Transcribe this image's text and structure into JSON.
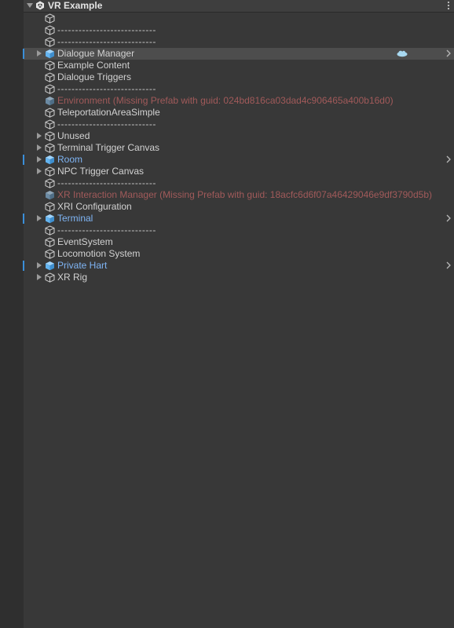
{
  "scene": {
    "title": "VR Example"
  },
  "rows": [
    {
      "label": "",
      "icon": "cube-outline-icon"
    },
    {
      "label": "----------------------------",
      "icon": "cube-outline-icon"
    },
    {
      "label": "----------------------------",
      "icon": "cube-outline-icon"
    },
    {
      "label": "Dialogue Manager",
      "icon": "prefab-cube-icon",
      "foldout": true,
      "selected": true,
      "chevron": true,
      "cloud": true
    },
    {
      "label": "Example Content",
      "icon": "cube-outline-icon"
    },
    {
      "label": "Dialogue Triggers",
      "icon": "cube-outline-icon"
    },
    {
      "label": "----------------------------",
      "icon": "cube-outline-icon"
    },
    {
      "label": "Environment (Missing Prefab with guid: 024bd816ca03dad4c906465a400b16d0)",
      "icon": "missing-prefab-icon",
      "kind": "missing"
    },
    {
      "label": "TeleportationAreaSimple",
      "icon": "cube-outline-icon"
    },
    {
      "label": "----------------------------",
      "icon": "cube-outline-icon"
    },
    {
      "label": "Unused",
      "icon": "cube-outline-icon",
      "foldout": true
    },
    {
      "label": "Terminal Trigger Canvas",
      "icon": "cube-outline-icon",
      "foldout": true
    },
    {
      "label": "Room",
      "icon": "prefab-cube-icon",
      "foldout": true,
      "kind": "prefab",
      "chevron": true,
      "mark": true
    },
    {
      "label": "NPC Trigger Canvas",
      "icon": "cube-outline-icon",
      "foldout": true
    },
    {
      "label": "----------------------------",
      "icon": "cube-outline-icon"
    },
    {
      "label": "XR Interaction Manager (Missing Prefab with guid: 18acfc6d6f07a46429046e9df3790d5b)",
      "icon": "missing-prefab-icon",
      "kind": "missing"
    },
    {
      "label": "XRI Configuration",
      "icon": "cube-outline-icon"
    },
    {
      "label": "Terminal",
      "icon": "prefab-cube-icon",
      "foldout": true,
      "kind": "prefab",
      "chevron": true,
      "mark": true
    },
    {
      "label": "----------------------------",
      "icon": "cube-outline-icon"
    },
    {
      "label": "EventSystem",
      "icon": "cube-outline-icon"
    },
    {
      "label": "Locomotion System",
      "icon": "cube-outline-icon"
    },
    {
      "label": "Private Hart",
      "icon": "prefab-cube-icon",
      "foldout": true,
      "kind": "prefab",
      "chevron": true,
      "mark": true
    },
    {
      "label": "XR Rig",
      "icon": "cube-outline-icon",
      "foldout": true
    }
  ],
  "colors": {
    "background": "#383838",
    "text": "#d2d2d2",
    "prefab_text": "#7fb5f5",
    "missing_text": "#a15a5a",
    "selection_marker": "#3a8fd9",
    "prefab_icon": "#64b4f0"
  }
}
